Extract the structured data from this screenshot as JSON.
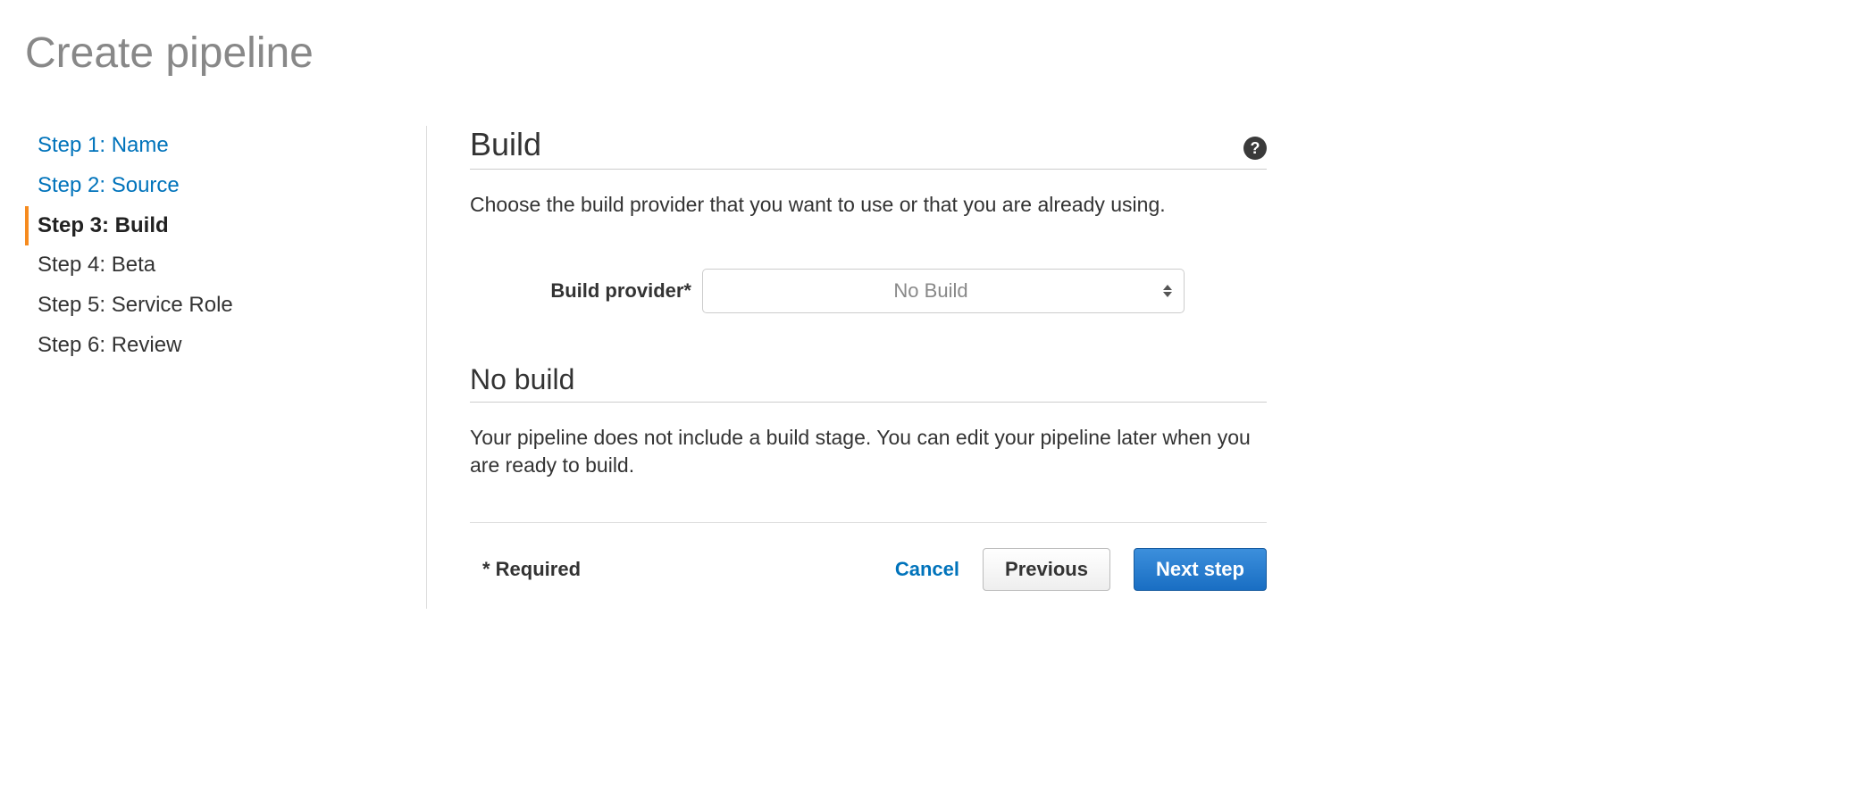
{
  "page": {
    "title": "Create pipeline"
  },
  "sidebar": {
    "steps": [
      {
        "label": "Step 1: Name",
        "state": "completed"
      },
      {
        "label": "Step 2: Source",
        "state": "completed"
      },
      {
        "label": "Step 3: Build",
        "state": "current"
      },
      {
        "label": "Step 4: Beta",
        "state": "future"
      },
      {
        "label": "Step 5: Service Role",
        "state": "future"
      },
      {
        "label": "Step 6: Review",
        "state": "future"
      }
    ]
  },
  "build": {
    "heading": "Build",
    "description": "Choose the build provider that you want to use or that you are already using.",
    "field_label": "Build provider*",
    "provider_selected": "No Build"
  },
  "no_build": {
    "heading": "No build",
    "description": "Your pipeline does not include a build stage. You can edit your pipeline later when you are ready to build."
  },
  "footer": {
    "required_note": "* Required",
    "cancel": "Cancel",
    "previous": "Previous",
    "next": "Next step"
  }
}
